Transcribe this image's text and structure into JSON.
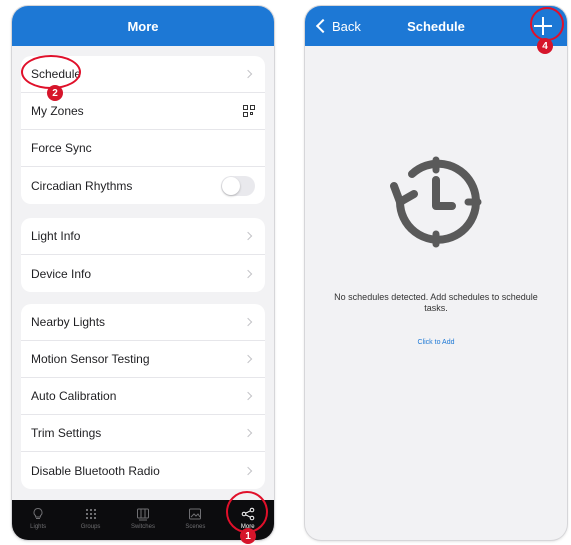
{
  "left": {
    "header_title": "More",
    "group1": [
      {
        "label": "Schedule",
        "accessory": "chevron"
      },
      {
        "label": "My Zones",
        "accessory": "qr-icon"
      },
      {
        "label": "Force Sync",
        "accessory": "none"
      },
      {
        "label": "Circadian Rhythms",
        "accessory": "toggle-off"
      }
    ],
    "group2": [
      {
        "label": "Light Info",
        "accessory": "chevron"
      },
      {
        "label": "Device Info",
        "accessory": "chevron"
      }
    ],
    "group3": [
      {
        "label": "Nearby Lights",
        "accessory": "chevron"
      },
      {
        "label": "Motion Sensor Testing",
        "accessory": "chevron"
      },
      {
        "label": "Auto Calibration",
        "accessory": "chevron"
      },
      {
        "label": "Trim Settings",
        "accessory": "chevron"
      },
      {
        "label": "Disable Bluetooth Radio",
        "accessory": "chevron"
      }
    ],
    "tabs": [
      {
        "label": "Lights",
        "icon": "bulb-icon",
        "active": false
      },
      {
        "label": "Groups",
        "icon": "groups-icon",
        "active": false
      },
      {
        "label": "Switches",
        "icon": "switches-icon",
        "active": false
      },
      {
        "label": "Scenes",
        "icon": "scenes-icon",
        "active": false
      },
      {
        "label": "More",
        "icon": "share-nodes-icon",
        "active": true
      }
    ]
  },
  "right": {
    "back_label": "Back",
    "header_title": "Schedule",
    "add_icon": "plus-icon",
    "empty_message": "No schedules detected. Add schedules to schedule tasks.",
    "click_to_add": "Click to Add",
    "empty_icon": "clock-refresh-icon"
  },
  "annotations": {
    "badges": [
      "1",
      "2",
      "4"
    ],
    "color": "#d6152b"
  },
  "colors": {
    "header": "#1d78d5",
    "tabbar": "#0c0c0e",
    "background": "#f2f2f4"
  }
}
